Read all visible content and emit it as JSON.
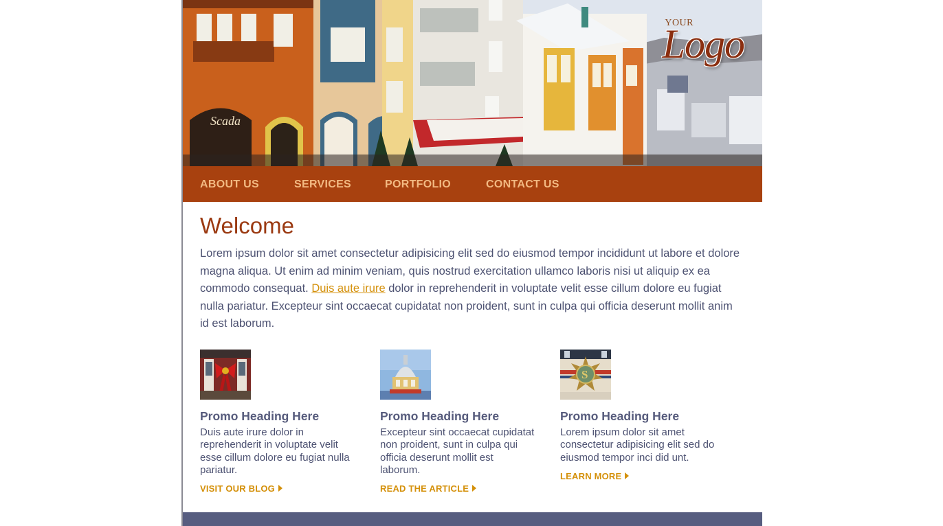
{
  "header": {
    "logo_small": "YOUR",
    "logo_main": "Logo"
  },
  "nav": {
    "items": [
      {
        "label": "ABOUT US"
      },
      {
        "label": "SERVICES"
      },
      {
        "label": "PORTFOLIO"
      },
      {
        "label": "CONTACT US"
      }
    ]
  },
  "main": {
    "title": "Welcome",
    "intro_before": "Lorem ipsum dolor sit amet consectetur adipisicing elit sed do eiusmod tempor incididunt ut labore et dolore magna aliqua. Ut enim ad minim veniam, quis nostrud exercitation ullamco laboris nisi ut aliquip ex ea commodo consequat. ",
    "intro_link": "Duis aute irure",
    "intro_after": " dolor in reprehenderit in voluptate velit esse cillum dolore eu fugiat nulla pariatur. Excepteur sint occaecat cupidatat non proident, sunt in culpa qui officia deserunt mollit anim id est laborum."
  },
  "promos": [
    {
      "heading": "Promo Heading Here",
      "text": "Duis aute irure dolor in reprehenderit in voluptate velit esse cillum dolore eu fugiat nulla pariatur.",
      "link": "VISIT OUR BLOG"
    },
    {
      "heading": "Promo Heading Here",
      "text": "Excepteur sint occaecat cupidatat non proident, sunt in culpa qui officia deserunt mollit est laborum.",
      "link": "READ THE ARTICLE"
    },
    {
      "heading": "Promo Heading Here",
      "text": "Lorem ipsum dolor sit amet consectetur adipisicing elit sed do eiusmod tempor inci did unt.",
      "link": "LEARN MORE"
    }
  ],
  "colors": {
    "nav_bg": "#a8410f",
    "nav_text": "#f2b982",
    "title": "#9b3a12",
    "body_text": "#4d5272",
    "link": "#d4900a",
    "footer_bar": "#575d80"
  }
}
